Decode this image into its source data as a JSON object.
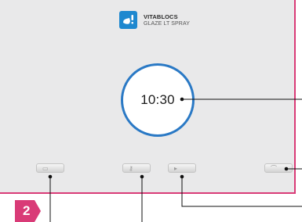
{
  "product": {
    "brand": "VITABLOCS",
    "name": "GLAZE LT SPRAY",
    "logo_icon": "spray-logo-icon",
    "logo_color": "#1e88cf"
  },
  "timer": {
    "value": "10:30",
    "ring_color": "#2a79c5"
  },
  "buttons": [
    {
      "name": "left-button",
      "icon": "info-icon"
    },
    {
      "name": "key-button",
      "icon": "key-icon"
    },
    {
      "name": "middle-button",
      "icon": "play-icon"
    },
    {
      "name": "right-button",
      "icon": "hook-icon"
    }
  ],
  "step": {
    "number": "2",
    "color": "#d93b77"
  },
  "colors": {
    "frame_border": "#d93b77",
    "screen_bg": "#e9e9ea"
  }
}
